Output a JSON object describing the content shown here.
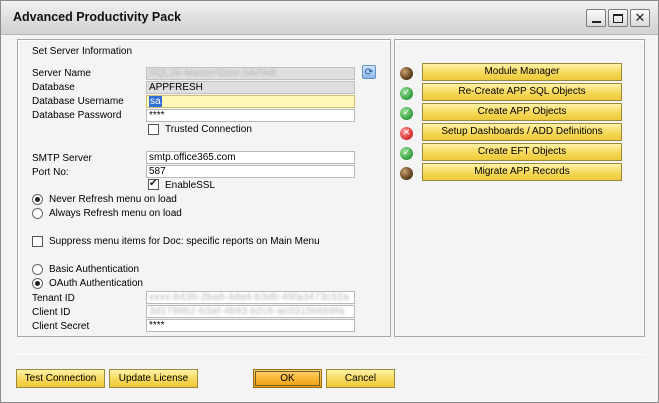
{
  "window": {
    "title": "Advanced Productivity Pack"
  },
  "server": {
    "section_title": "Set Server Information",
    "server_name_label": "Server Name",
    "server_name_value": "SQL2k-Master\\Dev-SAPAB",
    "database_label": "Database",
    "database_value": "APPFRESH",
    "db_user_label": "Database Username",
    "db_user_value": "sa",
    "db_password_label": "Database Password",
    "db_password_value": "****",
    "trusted_label": "Trusted Connection",
    "trusted_checked": false
  },
  "smtp": {
    "server_label": "SMTP Server",
    "server_value": "smtp.office365.com",
    "port_label": "Port No:",
    "port_value": "587",
    "ssl_label": "EnableSSL",
    "ssl_checked": true
  },
  "refresh": {
    "never_label": "Never Refresh menu on load",
    "always_label": "Always Refresh menu on load",
    "selected": "never"
  },
  "suppress": {
    "label": "Suppress menu items for Doc: specific reports on Main Menu",
    "checked": false
  },
  "auth": {
    "basic_label": "Basic Authentication",
    "oauth_label": "OAuth Authentication",
    "selected": "oauth",
    "tenant_label": "Tenant ID",
    "tenant_value": "xxxx-b436-2ba8-4da4-b3db-49fa3473c52a",
    "client_label": "Client ID",
    "client_value": "3d1799b2-b3af-4b93-b2c6-ac0315b6b9fa",
    "secret_label": "Client Secret",
    "secret_value": "****"
  },
  "actions": [
    {
      "label": "Module Manager",
      "status": "pending",
      "icon": "dark-bullet-icon"
    },
    {
      "label": "Re-Create APP SQL Objects",
      "status": "ok",
      "icon": "green-check-icon"
    },
    {
      "label": "Create APP Objects",
      "status": "ok",
      "icon": "green-check-icon"
    },
    {
      "label": "Setup Dashboards / ADD Definitions",
      "status": "error",
      "icon": "red-x-icon"
    },
    {
      "label": "Create EFT Objects",
      "status": "ok",
      "icon": "green-check-icon"
    },
    {
      "label": "Migrate APP Records",
      "status": "pending",
      "icon": "dark-bullet-icon"
    }
  ],
  "footer": {
    "test_connection": "Test Connection",
    "update_license": "Update License",
    "ok": "OK",
    "cancel": "Cancel"
  },
  "colors": {
    "button_gold": "#f6d95a",
    "ok_orange": "#f7b52e",
    "focus_yellow": "#fff8b8",
    "status_ok": "#2f9b3b",
    "status_error": "#d62b2b"
  }
}
